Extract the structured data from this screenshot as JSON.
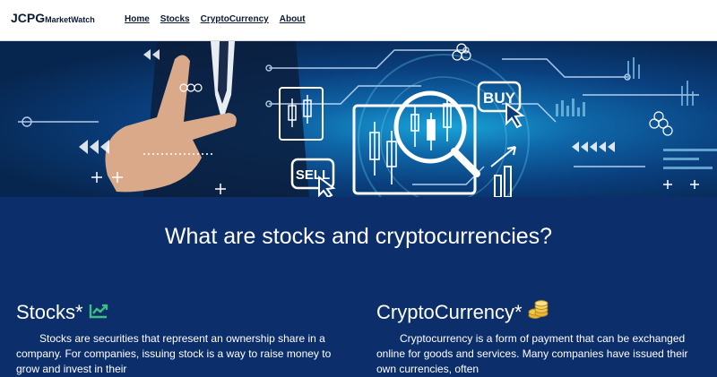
{
  "navbar": {
    "brand_main": "JCPG",
    "brand_sub": "MarketWatch",
    "links": [
      "Home",
      "Stocks",
      "CryptoCurrency",
      "About"
    ]
  },
  "hero": {
    "buy_label": "BUY",
    "sell_label": "SELL"
  },
  "content": {
    "heading": "What are stocks and cryptocurrencies?",
    "stocks": {
      "title": "Stocks*",
      "text": "Stocks are securities that represent an ownership share in a company. For companies, issuing stock is a way to raise money to grow and invest in their"
    },
    "crypto": {
      "title": "CryptoCurrency*",
      "text": "Cryptocurrency is a form of payment that can be exchanged online for goods and services. Many companies have issued their own currencies, often"
    }
  },
  "colors": {
    "nav_bg": "#ffffff",
    "content_bg": "#0c2f6b",
    "accent_green": "#3fbf7f",
    "coin_gold": "#e9b83a"
  },
  "icons": [
    "chart-up-icon",
    "coins-icon",
    "buy-icon",
    "sell-icon",
    "cursor-icon"
  ]
}
